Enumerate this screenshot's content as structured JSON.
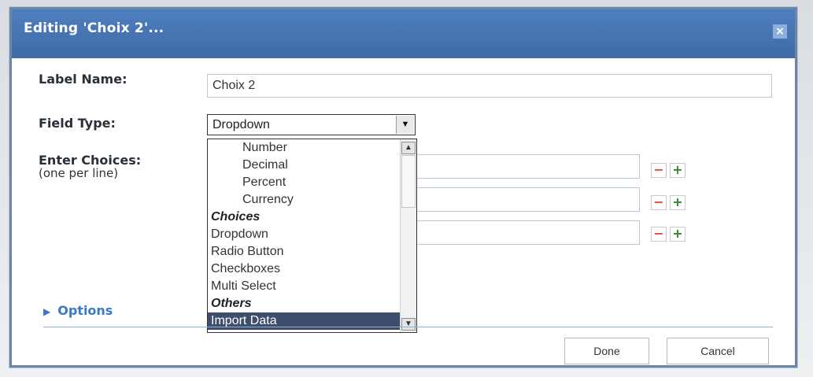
{
  "dialog": {
    "title": "Editing 'Choix 2'...",
    "close_label": "×"
  },
  "form": {
    "label_name_label": "Label Name:",
    "label_name_value": "Choix 2",
    "field_type_label": "Field Type:",
    "field_type_value": "Dropdown",
    "enter_choices_label": "Enter Choices:",
    "enter_choices_hint": "(one per line)"
  },
  "dropdown": {
    "options": [
      {
        "label": "Number",
        "kind": "indent"
      },
      {
        "label": "Decimal",
        "kind": "indent"
      },
      {
        "label": "Percent",
        "kind": "indent"
      },
      {
        "label": "Currency",
        "kind": "indent"
      },
      {
        "label": "Choices",
        "kind": "group"
      },
      {
        "label": "Dropdown",
        "kind": "option"
      },
      {
        "label": "Radio Button",
        "kind": "option"
      },
      {
        "label": "Checkboxes",
        "kind": "option"
      },
      {
        "label": "Multi Select",
        "kind": "option"
      },
      {
        "label": "Others",
        "kind": "group"
      },
      {
        "label": "Import Data",
        "kind": "selected"
      }
    ]
  },
  "choice_rows": [
    {
      "minus": "−",
      "plus": "+"
    },
    {
      "minus": "−",
      "plus": "+"
    },
    {
      "minus": "−",
      "plus": "+"
    }
  ],
  "options_toggle": {
    "label": "Options",
    "arrow": "▶"
  },
  "buttons": {
    "done": "Done",
    "cancel": "Cancel"
  },
  "icons": {
    "dropdown_arrow": "▼",
    "scroll_up": "▲",
    "scroll_down": "▼"
  },
  "colors": {
    "title_bar": "#4a79b8",
    "accent_link": "#3a79c6",
    "selection": "#3d4f6d"
  }
}
